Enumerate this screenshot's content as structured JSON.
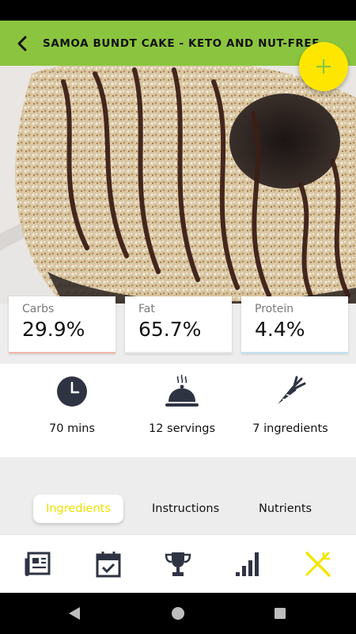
{
  "header": {
    "title": "SAMOA BUNDT CAKE - KETO AND NUT-FREE",
    "back_icon": "chevron-left-icon"
  },
  "fab": {
    "icon": "plus-icon",
    "color": "#ffe600"
  },
  "hero": {
    "alt": "Samoa bundt cake with coconut and chocolate drizzle"
  },
  "macros": [
    {
      "label": "Carbs",
      "value": "29.9%",
      "accent": "#f2b7a8"
    },
    {
      "label": "Fat",
      "value": "65.7%",
      "accent": "#e6e6e6"
    },
    {
      "label": "Protein",
      "value": "4.4%",
      "accent": "#bfe3f2"
    }
  ],
  "stats": [
    {
      "icon": "clock-icon",
      "text": "70 mins"
    },
    {
      "icon": "serving-cloche-icon",
      "text": "12 servings"
    },
    {
      "icon": "carrot-icon",
      "text": "7 ingredients"
    }
  ],
  "tabs": [
    {
      "label": "Ingredients",
      "active": true
    },
    {
      "label": "Instructions",
      "active": false
    },
    {
      "label": "Nutrients",
      "active": false
    }
  ],
  "bottom_nav": [
    {
      "icon": "news-icon"
    },
    {
      "icon": "calendar-check-icon"
    },
    {
      "icon": "trophy-icon"
    },
    {
      "icon": "bar-chart-icon"
    },
    {
      "icon": "fork-knife-icon",
      "active": true
    }
  ],
  "colors": {
    "brand_green": "#8bc53f",
    "accent_yellow": "#ffe600",
    "icon_dark": "#2f3443"
  }
}
